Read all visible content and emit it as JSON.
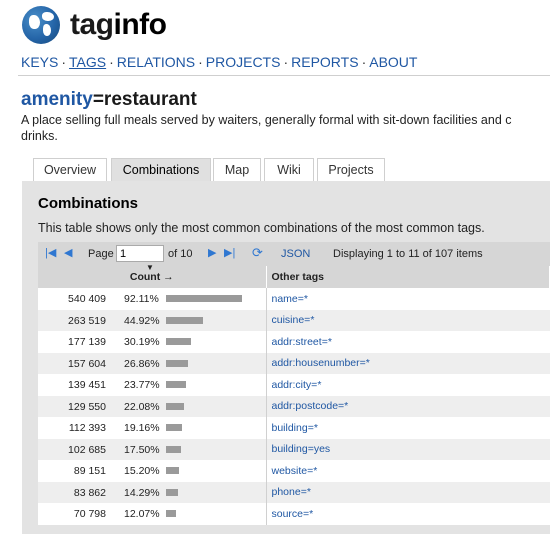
{
  "logo": {
    "text_tag": "tag",
    "text_info": "info"
  },
  "nav": [
    {
      "label": "KEYS",
      "active": false
    },
    {
      "label": "TAGS",
      "active": true
    },
    {
      "label": "RELATIONS",
      "active": false
    },
    {
      "label": "PROJECTS",
      "active": false
    },
    {
      "label": "REPORTS",
      "active": false
    },
    {
      "label": "ABOUT",
      "active": false
    }
  ],
  "nav_sep": "·",
  "page": {
    "key": "amenity",
    "eq": "=",
    "value": "restaurant",
    "description_line1": "A place selling full meals served by waiters, generally formal with sit-down facilities and c",
    "description_line2": "drinks."
  },
  "tabs": [
    {
      "label": "Overview",
      "active": false
    },
    {
      "label": "Combinations",
      "active": true
    },
    {
      "label": "Map",
      "active": false
    },
    {
      "label": "Wiki",
      "active": false
    },
    {
      "label": "Projects",
      "active": false
    }
  ],
  "panel": {
    "heading": "Combinations",
    "intro": "This table shows only the most common combinations of the most common tags."
  },
  "pager": {
    "first_icon": "first-page-icon",
    "prev_icon": "prev-page-icon",
    "page_label": "Page",
    "page_value": "1",
    "of_label": "of 10",
    "next_icon": "next-page-icon",
    "last_icon": "last-page-icon",
    "reload_icon": "reload-icon",
    "json_label": "JSON",
    "display_text": "Displaying 1 to 11 of 107 items"
  },
  "table": {
    "col_count": "Count",
    "col_count_arrow": "→",
    "col_other": "Other tags",
    "rows": [
      {
        "count": "540 409",
        "percent": "92.11%",
        "fraction": 0.9211,
        "tag": "name=*"
      },
      {
        "count": "263 519",
        "percent": "44.92%",
        "fraction": 0.4492,
        "tag": "cuisine=*"
      },
      {
        "count": "177 139",
        "percent": "30.19%",
        "fraction": 0.3019,
        "tag": "addr:street=*"
      },
      {
        "count": "157 604",
        "percent": "26.86%",
        "fraction": 0.2686,
        "tag": "addr:housenumber=*"
      },
      {
        "count": "139 451",
        "percent": "23.77%",
        "fraction": 0.2377,
        "tag": "addr:city=*"
      },
      {
        "count": "129 550",
        "percent": "22.08%",
        "fraction": 0.2208,
        "tag": "addr:postcode=*"
      },
      {
        "count": "112 393",
        "percent": "19.16%",
        "fraction": 0.1916,
        "tag": "building=*"
      },
      {
        "count": "102 685",
        "percent": "17.50%",
        "fraction": 0.175,
        "tag": "building=yes"
      },
      {
        "count": "89 151",
        "percent": "15.20%",
        "fraction": 0.152,
        "tag": "website=*"
      },
      {
        "count": "83 862",
        "percent": "14.29%",
        "fraction": 0.1429,
        "tag": "phone=*"
      },
      {
        "count": "70 798",
        "percent": "12.07%",
        "fraction": 0.1207,
        "tag": "source=*"
      }
    ]
  },
  "colors": {
    "link": "#1f57a3",
    "bar": "#9a9a9a",
    "panel_bg": "#e3e3e3"
  }
}
